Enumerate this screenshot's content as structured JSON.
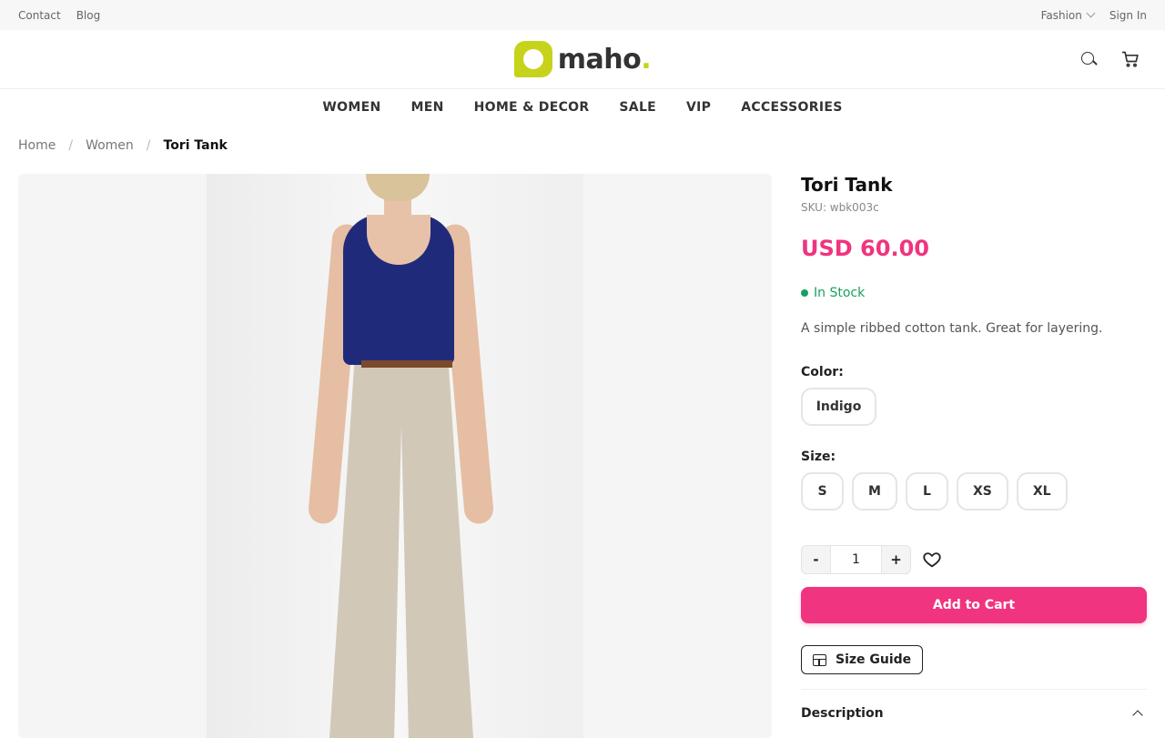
{
  "topbar": {
    "links": [
      "Contact",
      "Blog"
    ],
    "store": "Fashion",
    "sign_in": "Sign In"
  },
  "header": {
    "logo_text": "maho",
    "logo_dot": ".",
    "icons": [
      "search-icon",
      "cart-icon"
    ]
  },
  "nav": [
    "WOMEN",
    "MEN",
    "HOME & DECOR",
    "SALE",
    "VIP",
    "ACCESSORIES"
  ],
  "breadcrumb": {
    "home": "Home",
    "sep": "/",
    "category": "Women",
    "current": "Tori Tank"
  },
  "product": {
    "title": "Tori Tank",
    "sku": "SKU: wbk003c",
    "price": "USD 60.00",
    "stock": "In Stock",
    "description": "A simple ribbed cotton tank. Great for layering.",
    "color_label": "Color:",
    "colors": [
      "Indigo"
    ],
    "size_label": "Size:",
    "sizes": [
      "S",
      "M",
      "L",
      "XS",
      "XL"
    ],
    "qty_minus": "-",
    "qty_plus": "+",
    "qty_value": "1",
    "add_to_cart": "Add to Cart",
    "size_guide": "Size Guide",
    "description_heading": "Description"
  },
  "colors": {
    "accent": "#f0347f",
    "in_stock": "#17a05d",
    "brand": "#c6d31a",
    "tank": "#1f2b7a",
    "pants": "#d2c8b8"
  }
}
